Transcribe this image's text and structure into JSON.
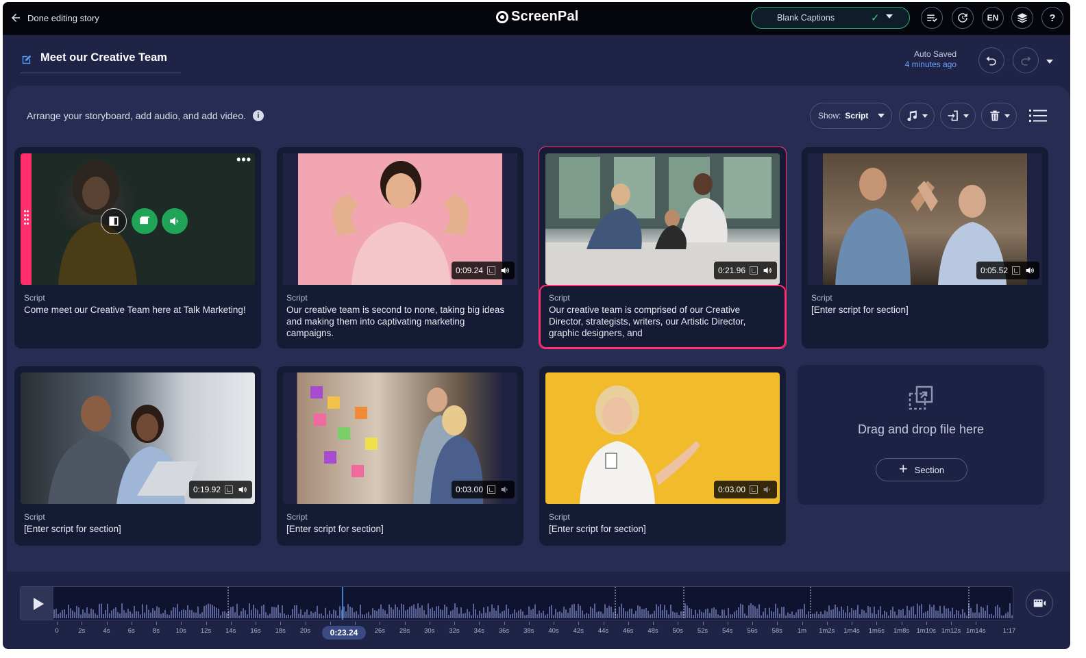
{
  "topbar": {
    "back_label": "Done editing story",
    "logo_text": "ScreenPal",
    "captions_label": "Blank Captions",
    "language": "EN",
    "icons": [
      "captions-list-icon",
      "history-icon",
      "layers-icon",
      "help-icon"
    ]
  },
  "story": {
    "title": "Meet our Creative Team",
    "autosave_label": "Auto Saved",
    "autosave_time": "4 minutes ago"
  },
  "toolbar": {
    "instruction": "Arrange your storyboard, add audio, and add video.",
    "show_label": "Show:",
    "show_value": "Script"
  },
  "sections": [
    {
      "label": "Script",
      "text": "Come meet our Creative Team here at Talk Marketing!",
      "duration": "",
      "muted": false
    },
    {
      "label": "Script",
      "text": "Our creative team is second to none, taking big ideas and making them into captivating marketing campaigns.",
      "duration": "0:09.24",
      "muted": false
    },
    {
      "label": "Script",
      "text": "Our creative team is comprised of our Creative Director, strategists, writers, our Artistic Director, graphic designers, and",
      "duration": "0:21.96",
      "muted": false
    },
    {
      "label": "Script",
      "text": "[Enter script for section]",
      "duration": "0:05.52",
      "muted": false
    },
    {
      "label": "Script",
      "text": "[Enter script for section]",
      "duration": "0:19.92",
      "muted": false
    },
    {
      "label": "Script",
      "text": "[Enter script for section]",
      "duration": "0:03.00",
      "muted": true
    },
    {
      "label": "Script",
      "text": "[Enter script for section]",
      "duration": "0:03.00",
      "muted": true
    }
  ],
  "dropzone": {
    "text": "Drag and drop file here",
    "button_label": "Section"
  },
  "timeline": {
    "playhead": "0:23.24",
    "end": "1:17",
    "ticks": [
      "0",
      "2s",
      "4s",
      "6s",
      "8s",
      "10s",
      "12s",
      "14s",
      "16s",
      "18s",
      "20s",
      "22s",
      "24s",
      "26s",
      "28s",
      "30s",
      "32s",
      "34s",
      "36s",
      "38s",
      "40s",
      "42s",
      "44s",
      "46s",
      "48s",
      "50s",
      "52s",
      "54s",
      "56s",
      "58s",
      "1m",
      "1m2s",
      "1m4s",
      "1m6s",
      "1m8s",
      "1m10s",
      "1m12s",
      "1m14s"
    ]
  },
  "colors": {
    "accent": "#ff2f73",
    "caption_ok": "#2fae7b",
    "link": "#6ea3ff"
  }
}
